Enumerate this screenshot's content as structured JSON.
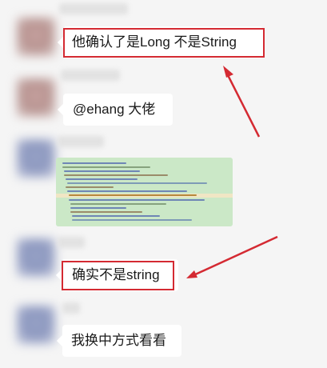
{
  "messages": [
    {
      "text": "他确认了是Long 不是String",
      "highlighted": true
    },
    {
      "text": "@ehang 大佬",
      "highlighted": false
    },
    {
      "text": "[code screenshot image]",
      "highlighted": false
    },
    {
      "text": "确实不是string",
      "highlighted": true
    },
    {
      "text": "我换中方式看看",
      "highlighted": false
    }
  ],
  "colors": {
    "background": "#f5f5f5",
    "bubble": "#ffffff",
    "highlight_box": "#d42a32",
    "arrow": "#d42a32",
    "code_bg": "#cbe8c7"
  }
}
